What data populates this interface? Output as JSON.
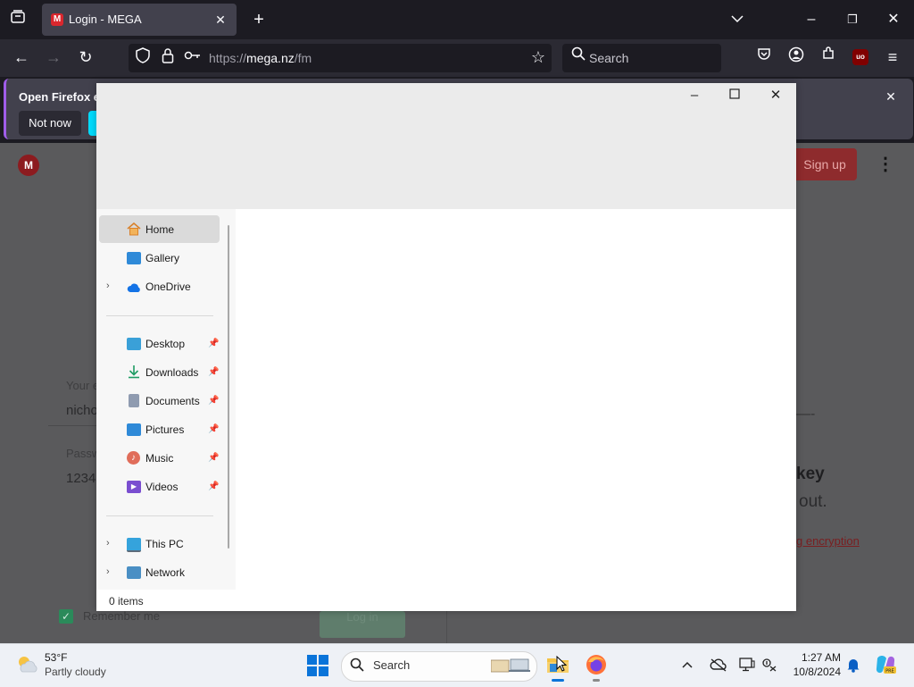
{
  "browser": {
    "tab_title": "Login - MEGA",
    "tab_favicon": "M",
    "url_prefix": "https://",
    "url_domain": "mega.nz",
    "url_path": "/fm",
    "search_placeholder": "Search"
  },
  "notification": {
    "text": "Open Firefox ev",
    "not_now": "Not now"
  },
  "page": {
    "logo": "M",
    "signup": "Sign up",
    "email_label": "Your e",
    "email_value": "nicho",
    "password_label": "Passw",
    "password_value": "1234",
    "remember": "Remember me",
    "login_btn": "Log in",
    "heading_partial": "key",
    "sub_partial": "out.",
    "link_partial": "g encryption",
    "dashes": "—-"
  },
  "explorer": {
    "nav_items": {
      "home": "Home",
      "gallery": "Gallery",
      "onedrive": "OneDrive",
      "desktop": "Desktop",
      "downloads": "Downloads",
      "documents": "Documents",
      "pictures": "Pictures",
      "music": "Music",
      "videos": "Videos",
      "thispc": "This PC",
      "network": "Network"
    },
    "status": "0 items"
  },
  "taskbar": {
    "weather_temp": "53°F",
    "weather_desc": "Partly cloudy",
    "search_placeholder": "Search",
    "time": "1:27 AM",
    "date": "10/8/2024"
  },
  "colors": {
    "firefox_dark": "#1c1b22",
    "mega_red": "#d9272e",
    "firefox_cyan": "#00ddff"
  }
}
